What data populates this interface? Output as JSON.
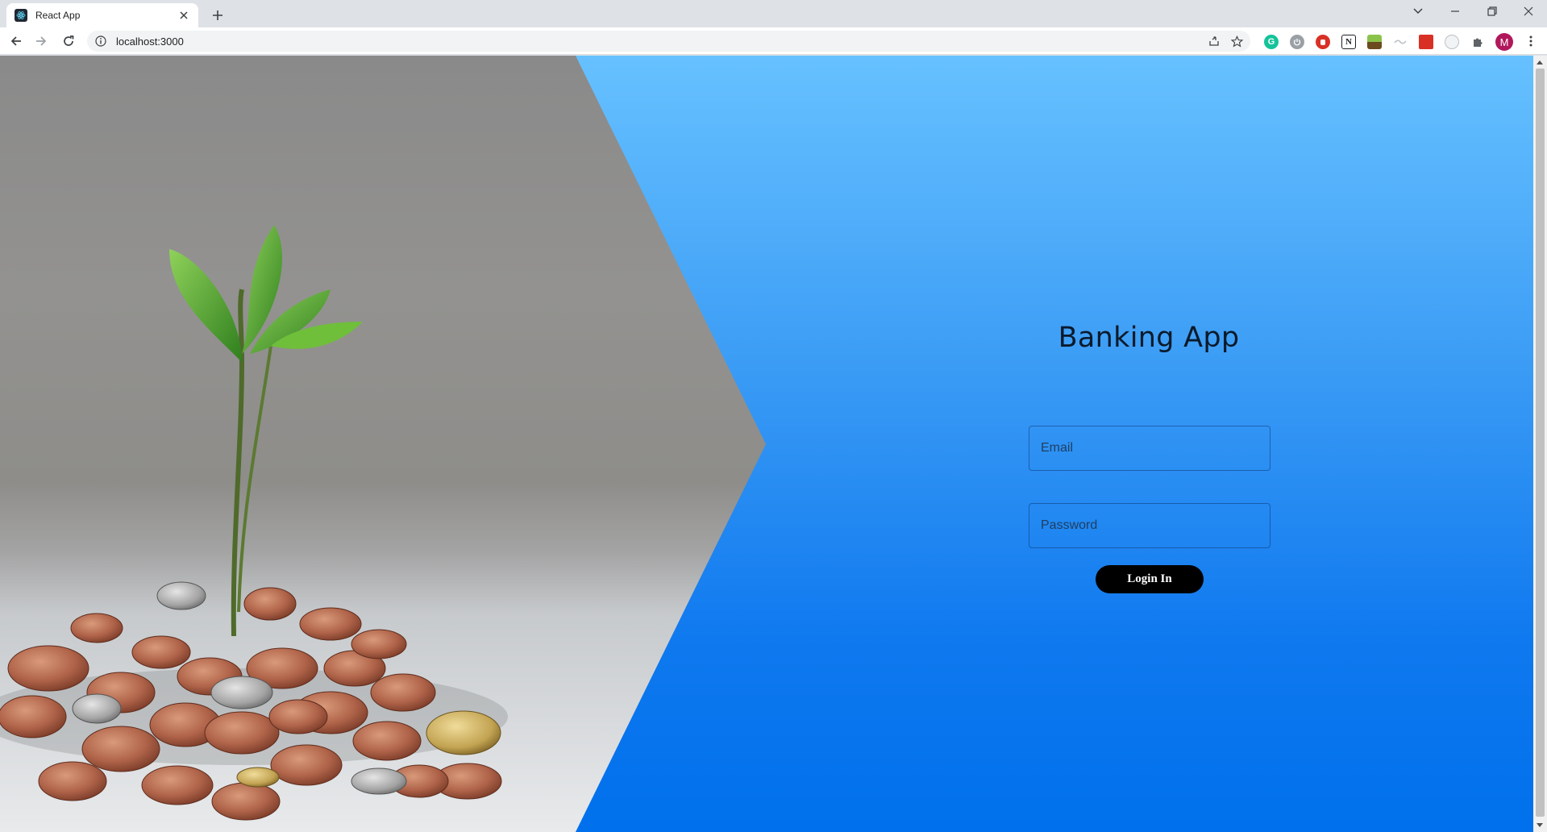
{
  "browser": {
    "tab": {
      "title": "React App",
      "favicon_icon": "react-icon"
    },
    "address": {
      "url": "localhost:3000"
    },
    "extensions": [
      {
        "icon": "grammarly-icon",
        "letter": "G",
        "color": "#15c39a"
      },
      {
        "icon": "power-icon",
        "letter": "",
        "color": "#9aa0a6"
      },
      {
        "icon": "adblock-icon",
        "letter": "",
        "color": "#d93025"
      },
      {
        "icon": "notion-icon",
        "letter": "N",
        "color": "#202124"
      },
      {
        "icon": "landscape-icon",
        "letter": "",
        "color": "#6d8a1f"
      },
      {
        "icon": "wave-icon",
        "letter": "",
        "color": "#bdc1c6"
      },
      {
        "icon": "book-icon",
        "letter": "",
        "color": "#d93025"
      },
      {
        "icon": "capture-icon",
        "letter": "",
        "color": "#bdc1c6"
      }
    ],
    "profile_initial": "M",
    "profile_color": "#b1185c"
  },
  "page": {
    "title": "Banking App",
    "email_placeholder": "Email",
    "password_placeholder": "Password",
    "login_label": "Login In",
    "background_top": "#67c1ff",
    "background_bottom": "#0070ec",
    "button_color": "#000000"
  }
}
